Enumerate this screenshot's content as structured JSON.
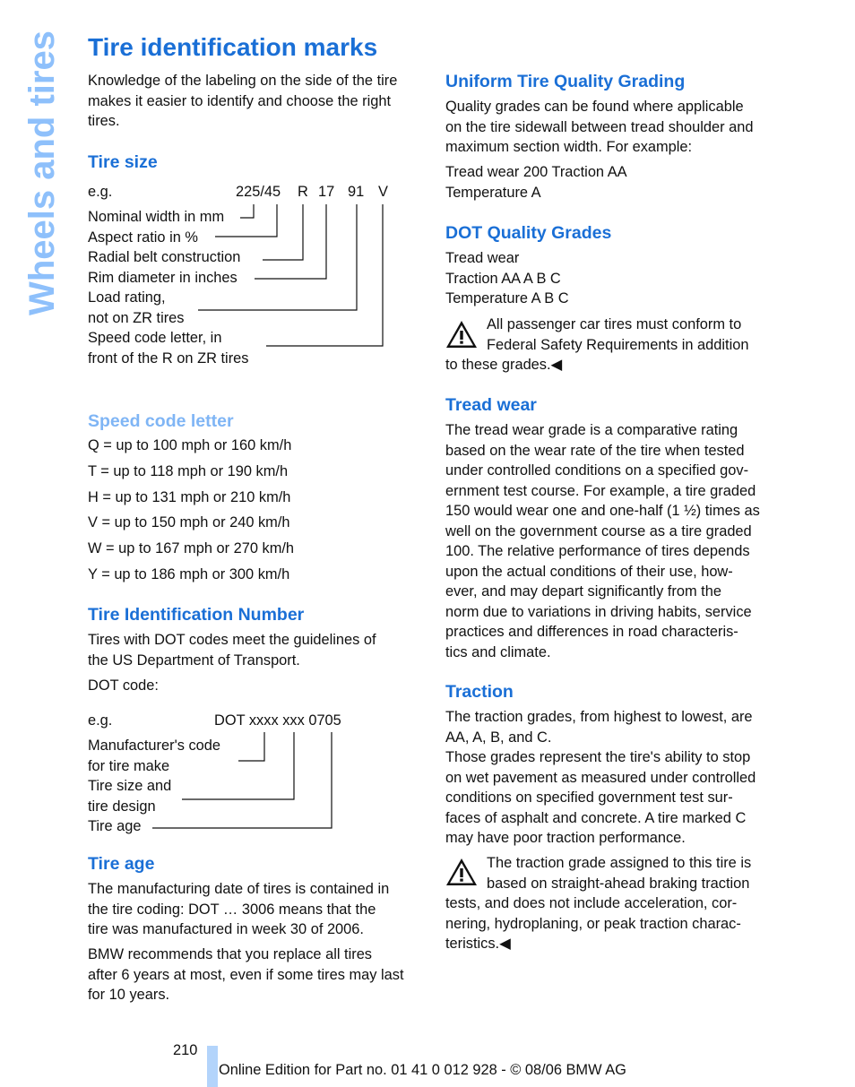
{
  "side_tab": "Wheels and tires",
  "title": "Tire identification marks",
  "left": {
    "intro": [
      "Knowledge of the labeling on the side of the tire",
      "makes it easier to identify and choose the right",
      "tires."
    ],
    "tire_size": {
      "heading": "Tire size",
      "eg": "e.g.",
      "code_parts": [
        "225/45",
        "R",
        "17",
        "91",
        "V"
      ],
      "labels": [
        "Nominal width in mm",
        "Aspect ratio in %",
        "Radial belt construction",
        "Rim diameter in inches",
        "Load rating,",
        "not on ZR tires",
        "Speed code letter, in",
        "front of the R on ZR tires"
      ]
    },
    "speed_code": {
      "heading": "Speed code letter",
      "items": [
        "Q = up to 100 mph or 160 km/h",
        "T = up to 118 mph or 190 km/h",
        "H = up to 131 mph or 210 km/h",
        "V = up to 150 mph or 240 km/h",
        "W = up to 167 mph or 270 km/h",
        "Y = up to 186 mph or 300 km/h"
      ]
    },
    "tin": {
      "heading": "Tire Identification Number",
      "text": [
        "Tires with DOT codes meet the guidelines of",
        "the US Department of Transport."
      ],
      "dot_code_label": "DOT code:",
      "eg": "e.g.",
      "code": "DOT xxxx xxx 0705",
      "labels": [
        "Manufacturer's code",
        "for tire make",
        "Tire size and",
        "tire design",
        "Tire age"
      ]
    },
    "tire_age": {
      "heading": "Tire age",
      "p1": [
        "The manufacturing date of tires is contained in",
        "the tire coding: DOT … 3006 means that the",
        "tire was manufactured in week 30 of 2006."
      ],
      "p2": [
        "BMW recommends that you replace all tires",
        "after 6 years at most, even if some tires may last",
        "for 10 years."
      ]
    }
  },
  "right": {
    "utqg": {
      "heading": "Uniform Tire Quality Grading",
      "p1": [
        "Quality grades can be found where applicable",
        "on the tire sidewall between tread shoulder and",
        "maximum section width. For example:"
      ],
      "p2": [
        "Tread wear 200 Traction AA",
        "Temperature A"
      ]
    },
    "dot_grades": {
      "heading": "DOT Quality Grades",
      "lines": [
        "Tread wear",
        "Traction AA A B C",
        "Temperature A B C"
      ],
      "warning": [
        "All passenger car tires must conform to",
        "Federal Safety Requirements in addition",
        "to these grades.◀"
      ]
    },
    "tread_wear": {
      "heading": "Tread wear",
      "lines": [
        "The tread wear grade is a comparative rating",
        "based on the wear rate of the tire when tested",
        "under controlled conditions on a specified gov-",
        "ernment test course. For example, a tire graded",
        "150 would wear one and one-half (1 ½) times as",
        "well on the government course as a tire graded",
        "100. The relative performance of tires depends",
        "upon the actual conditions of their use, how-",
        "ever, and may depart significantly from the",
        "norm due to variations in driving habits, service",
        "practices and differences in road characteris-",
        "tics and climate."
      ]
    },
    "traction": {
      "heading": "Traction",
      "lines": [
        "The traction grades, from highest to lowest, are",
        "AA, A, B, and C.",
        "Those grades represent the tire's ability to stop",
        "on wet pavement as measured under controlled",
        "conditions on specified government test sur-",
        "faces of asphalt and concrete. A tire marked C",
        "may have poor traction performance."
      ],
      "warning": [
        "The traction grade assigned to this tire is",
        "based on straight-ahead braking traction",
        "tests, and does not include acceleration, cor-",
        "nering, hydroplaning, or peak traction charac-",
        "teristics.◀"
      ]
    }
  },
  "footer": {
    "page_number": "210",
    "text": "Online Edition for Part no. 01 41 0 012 928 - © 08/06 BMW AG"
  },
  "colors": {
    "heading": "#1a6fd6",
    "side_tab": "#8ec0fb",
    "footer_bar": "#b3d4fb"
  }
}
